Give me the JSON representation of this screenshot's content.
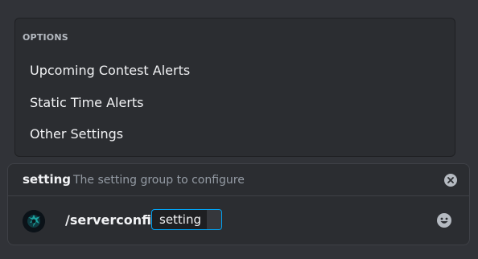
{
  "options": {
    "header": "OPTIONS",
    "items": [
      {
        "label": "Upcoming Contest Alerts"
      },
      {
        "label": "Static Time Alerts"
      },
      {
        "label": "Other Settings"
      }
    ]
  },
  "command_bar": {
    "param_name": "setting",
    "param_description": "The setting group to configure",
    "close_icon": "close-circle-icon",
    "avatar_icon": "bot-avatar",
    "command": "/serverconfig",
    "chip_label": "setting",
    "emoji_icon": "emoji-smile-icon"
  },
  "colors": {
    "background": "#313338",
    "panel": "#2b2d31",
    "accent": "#00a8fc"
  }
}
